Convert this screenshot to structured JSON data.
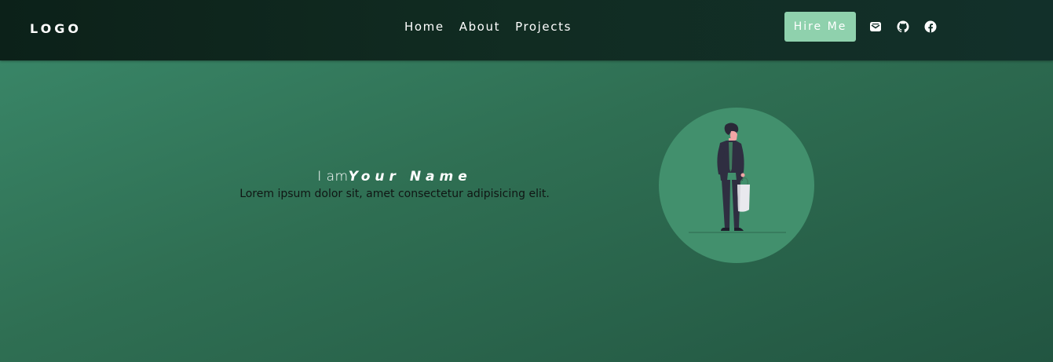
{
  "navbar": {
    "logo": "LOGO",
    "links": [
      {
        "label": "Home"
      },
      {
        "label": "About"
      },
      {
        "label": "Projects"
      }
    ],
    "hire_button": "Hire Me",
    "social_icons": [
      "mail-icon",
      "github-icon",
      "facebook-icon"
    ]
  },
  "hero": {
    "prefix": "I am",
    "name": "Your Name",
    "subtitle": "Lorem ipsum dolor sit, amet consectetur adipisicing elit."
  },
  "colors": {
    "navbar_bg": "#0f2a21",
    "hero_bg": "#2f6f53",
    "hire_button_bg": "#8fd1ad",
    "avatar_circle": "#42906d"
  }
}
